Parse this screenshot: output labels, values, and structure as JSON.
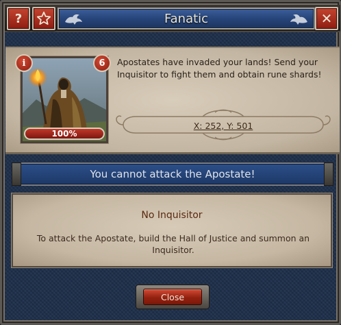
{
  "window": {
    "title": "Fanatic",
    "help_label": "?",
    "close_label": "✕"
  },
  "target": {
    "info_badge": "i",
    "level_badge": "6",
    "health_text": "100%",
    "description": "Apostates have invaded your lands! Send your Inquisitor to fight them and obtain rune shards!",
    "coordinates": "X: 252, Y: 501"
  },
  "banner": {
    "text": "You cannot attack the Apostate!"
  },
  "message": {
    "title": "No Inquisitor",
    "body": "To attack the Apostate, build the Hall of Justice and summon an Inquisitor."
  },
  "footer": {
    "close_label": "Close"
  },
  "icons": {
    "help": "question-mark-icon",
    "favorite": "star-icon",
    "close": "close-icon",
    "info": "info-icon",
    "decor": "griffin-icon"
  },
  "colors": {
    "accent_red": "#b12f1e",
    "title_blue": "#2b4a82",
    "parchment": "#cbbfad",
    "background": "#1e2f4a"
  }
}
